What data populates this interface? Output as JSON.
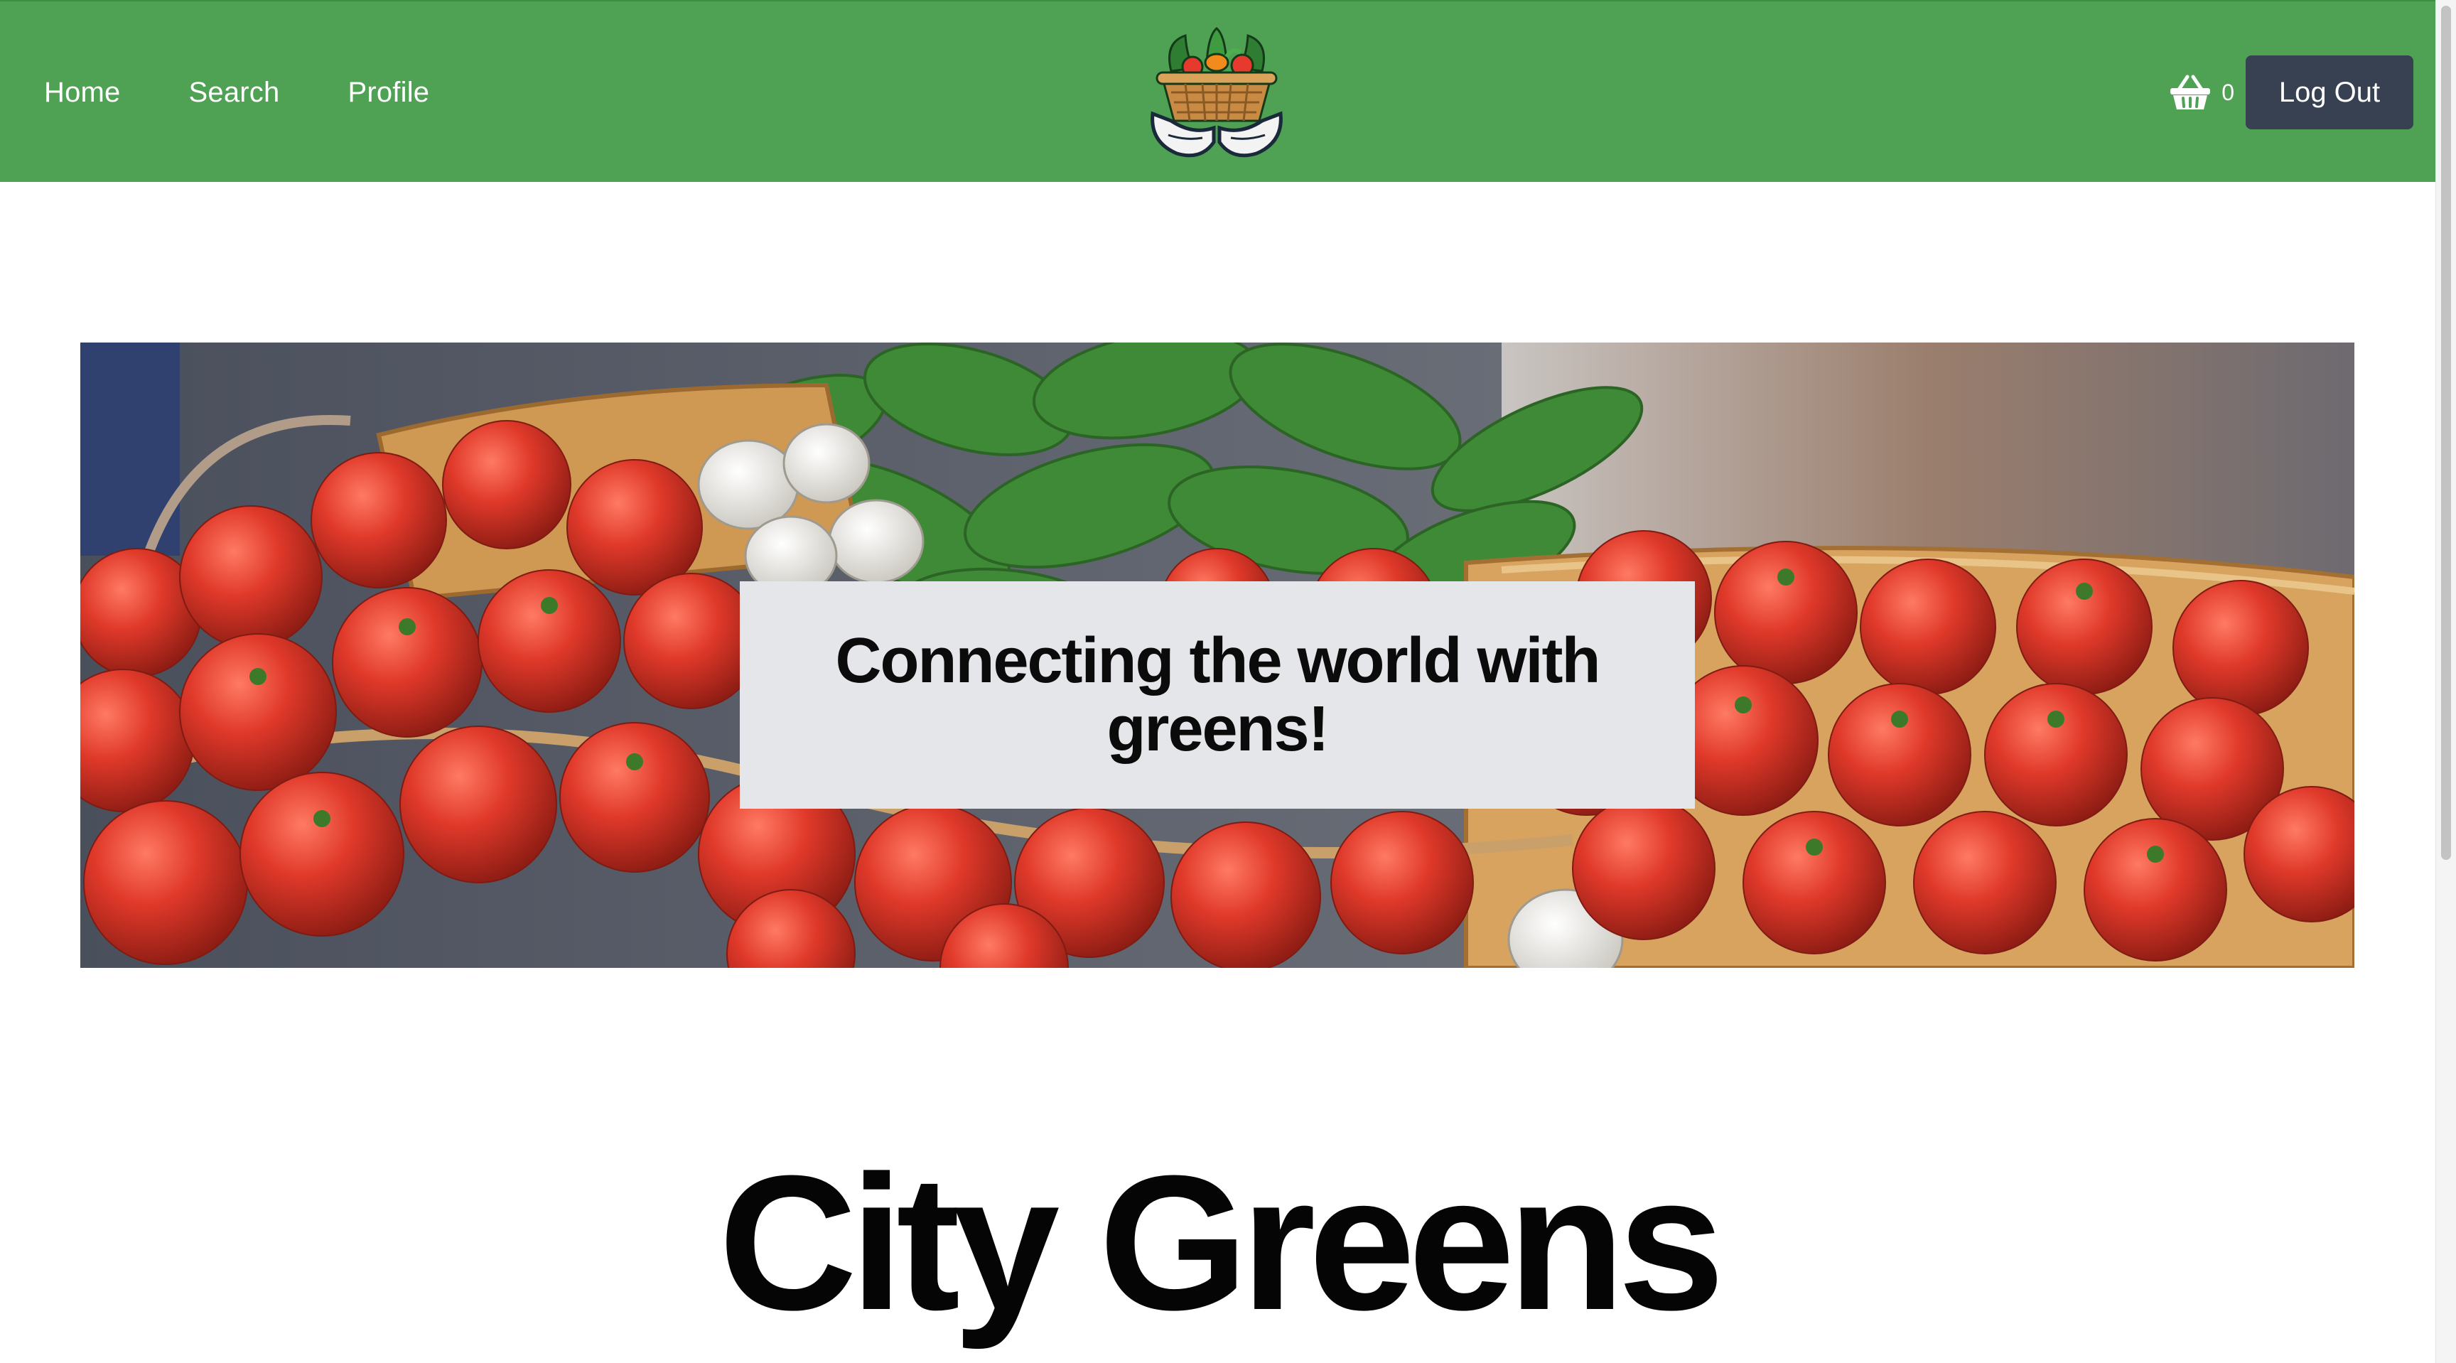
{
  "nav": {
    "links": [
      "Home",
      "Search",
      "Profile"
    ],
    "cart_count": "0",
    "logout_label": "Log Out",
    "logo_icon": "veggie-basket-hands-logo",
    "cart_icon": "shopping-basket-icon"
  },
  "hero": {
    "tagline": "Connecting the world with greens!",
    "image_subject": "tomatoes-basil-garlic-in-baskets"
  },
  "main": {
    "title": "City Greens"
  },
  "colors": {
    "navbar": "#4fa254",
    "logout_button": "#374151",
    "hero_box": "#e5e6ea",
    "text": "#050505"
  }
}
